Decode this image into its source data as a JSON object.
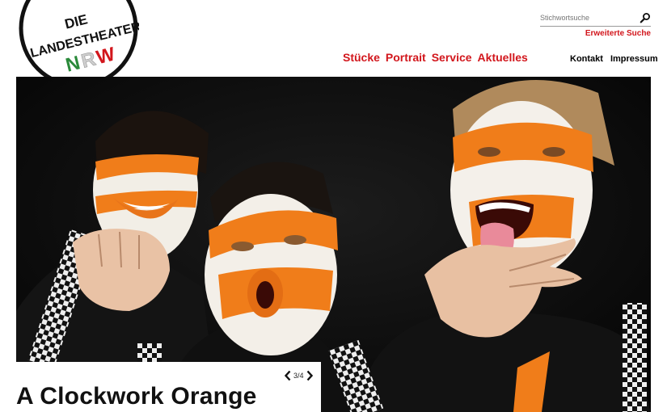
{
  "logo": {
    "line1": "DIE",
    "line2": "LANDESTHEATER",
    "mark_n": "N",
    "mark_r": "R",
    "mark_w": "W",
    "colors": {
      "n": "#2a8a3a",
      "r": "#c8c8c8",
      "w": "#d2161c"
    }
  },
  "search": {
    "placeholder": "Stichwortsuche",
    "icon": "search-icon",
    "advanced_label": "Erweiterte Suche"
  },
  "main_nav": {
    "items": [
      {
        "label": "Stücke"
      },
      {
        "label": "Portrait"
      },
      {
        "label": "Service"
      },
      {
        "label": "Aktuelles"
      }
    ]
  },
  "secondary_nav": {
    "items": [
      {
        "label": "Kontakt"
      },
      {
        "label": "Impressum"
      }
    ]
  },
  "slider": {
    "title": "A Clockwork Orange",
    "counter": "3/4",
    "prev_icon": "chevron-left-icon",
    "next_icon": "chevron-right-icon"
  },
  "colors": {
    "accent": "#d2161c",
    "paint_orange": "#f07d1a"
  }
}
